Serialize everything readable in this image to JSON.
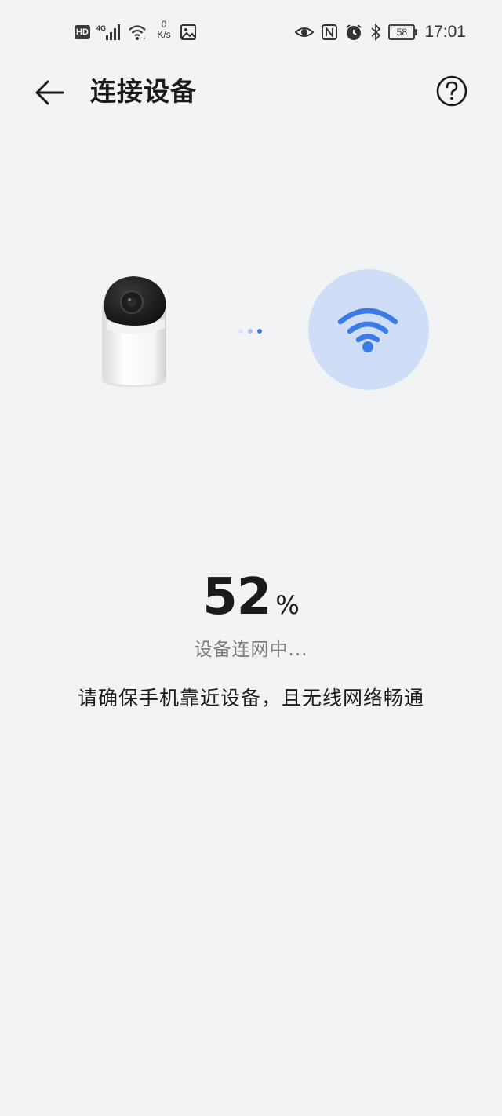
{
  "status_bar": {
    "hd_badge": "HD",
    "signal_label": "4G",
    "net_speed_value": "0",
    "net_speed_unit": "K/s",
    "battery": "58",
    "time": "17:01"
  },
  "header": {
    "title": "连接设备"
  },
  "progress": {
    "value": "52",
    "unit": "%",
    "percent": 52
  },
  "status_text": "设备连网中...",
  "hint_text": "请确保手机靠近设备，且无线网络畅通",
  "colors": {
    "background": "#f2f3f5",
    "accent": "#3a7be8",
    "wifi_circle": "#cfddf6"
  },
  "icons": {
    "back": "arrow-left-icon",
    "help": "question-circle-icon",
    "wifi": "wifi-icon",
    "camera": "security-camera-image"
  }
}
